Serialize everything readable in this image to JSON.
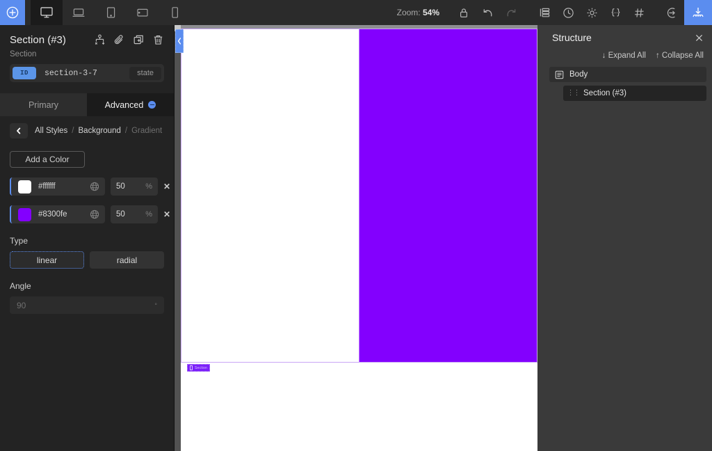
{
  "topbar": {
    "add_icon": "plus-circle-icon",
    "devices": [
      {
        "name": "desktop",
        "icon": "desktop-monitor-icon",
        "active": true
      },
      {
        "name": "laptop",
        "icon": "laptop-icon",
        "active": false
      },
      {
        "name": "tablet-portrait",
        "icon": "tablet-portrait-icon",
        "active": false
      },
      {
        "name": "tablet-landscape",
        "icon": "tablet-landscape-icon",
        "active": false
      },
      {
        "name": "mobile",
        "icon": "mobile-phone-icon",
        "active": false
      }
    ],
    "zoom_prefix": "Zoom:",
    "zoom_value": "54%",
    "tools": [
      {
        "name": "lock",
        "icon": "lock-icon"
      },
      {
        "name": "undo",
        "icon": "undo-arrow-icon"
      },
      {
        "name": "redo",
        "icon": "redo-arrow-icon"
      },
      {
        "name": "layers",
        "icon": "layers-list-icon"
      },
      {
        "name": "history",
        "icon": "clock-history-icon"
      },
      {
        "name": "settings",
        "icon": "gear-icon"
      },
      {
        "name": "code",
        "icon": "curly-braces-icon"
      },
      {
        "name": "grid",
        "icon": "hash-grid-icon"
      },
      {
        "name": "exit",
        "icon": "exit-arrow-icon"
      }
    ],
    "publish_icon": "publish-import-icon"
  },
  "left_panel": {
    "title": "Section (#3)",
    "subtitle": "Section",
    "header_icons": [
      {
        "name": "reparent",
        "icon": "reparent-node-icon"
      },
      {
        "name": "link",
        "icon": "paperclip-link-icon"
      },
      {
        "name": "duplicate",
        "icon": "duplicate-icon"
      },
      {
        "name": "delete",
        "icon": "trash-icon"
      }
    ],
    "id_badge": "ID",
    "id_value": "section-3-7",
    "state_label": "state",
    "tabs": [
      {
        "label": "Primary",
        "active": false
      },
      {
        "label": "Advanced",
        "active": true
      }
    ],
    "breadcrumb": {
      "back_icon": "chevron-left-icon",
      "items": [
        {
          "label": "All Styles",
          "dim": false
        },
        {
          "label": "Background",
          "dim": false
        },
        {
          "label": "Gradient",
          "dim": true
        }
      ],
      "separator": "/"
    },
    "add_color_label": "Add a Color",
    "colors": [
      {
        "hex": "#ffffff",
        "swatch": "#ffffff",
        "stop": "50",
        "unit": "%",
        "globe_icon": "globe-icon",
        "remove_icon": "close-x-icon"
      },
      {
        "hex": "#8300fe",
        "swatch": "#8300fe",
        "stop": "50",
        "unit": "%",
        "globe_icon": "globe-icon",
        "remove_icon": "close-x-icon"
      }
    ],
    "type_label": "Type",
    "type_options": [
      {
        "label": "linear",
        "selected": true
      },
      {
        "label": "radial",
        "selected": false
      }
    ],
    "angle_label": "Angle",
    "angle_value": "90",
    "angle_unit": "°"
  },
  "canvas": {
    "section_badge_label": "Section",
    "section_badge_icon": "section-block-icon",
    "gradient_from": "#ffffff",
    "gradient_to": "#8300fe",
    "gradient_stop": "50%",
    "outline_color": "#c9a6f5",
    "collapse_icon": "chevron-left-icon"
  },
  "right_panel": {
    "title": "Structure",
    "close_icon": "close-x-icon",
    "expand_all": "↓ Expand All",
    "collapse_all": "↑ Collapse All",
    "tree": [
      {
        "label": "Body",
        "icon": "body-document-icon",
        "depth": 0
      },
      {
        "label": "Section (#3)",
        "icon": "drag-grip-icon",
        "depth": 1
      }
    ]
  }
}
